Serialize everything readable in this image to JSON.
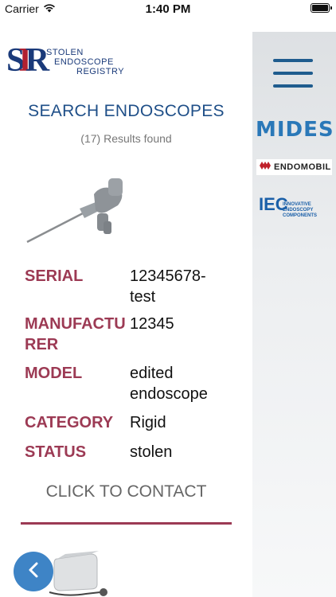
{
  "status_bar": {
    "carrier": "Carrier",
    "time": "1:40 PM"
  },
  "logo": {
    "line1": "STOLEN",
    "line2": "ENDOSCOPE",
    "line3": "REGISTRY"
  },
  "page_title": "SEARCH ENDOSCOPES",
  "results_text": "(17) Results found",
  "details": [
    {
      "label": "SERIAL",
      "value": "12345678-test"
    },
    {
      "label": "MANUFACTURER",
      "value": "12345"
    },
    {
      "label": "MODEL",
      "value": "edited endoscope"
    },
    {
      "label": "CATEGORY",
      "value": "Rigid"
    },
    {
      "label": "STATUS",
      "value": "stolen"
    }
  ],
  "contact_label": "CLICK TO CONTACT",
  "sidebar": {
    "brands": [
      {
        "name": "MIDES"
      },
      {
        "name": "ENDOMOBIL"
      },
      {
        "name": "IEC",
        "tagline": "INNOVATIVE ENDOSCOPY COMPONENTS"
      }
    ]
  },
  "colors": {
    "accent_blue": "#1f4f88",
    "label_red": "#9c3a54",
    "back_button": "#3e84c6"
  },
  "icons": [
    "wifi-icon",
    "battery-icon",
    "hamburger-menu-icon",
    "chevron-left-icon"
  ]
}
